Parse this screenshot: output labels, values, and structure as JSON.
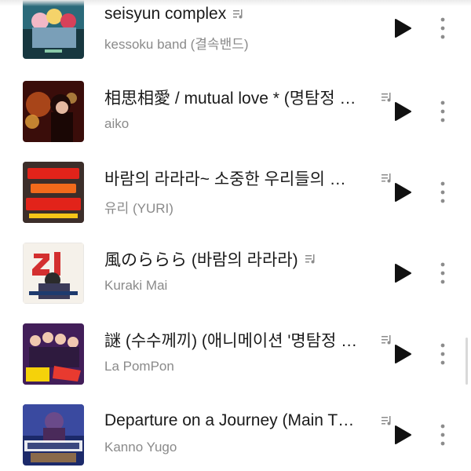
{
  "tracks": [
    {
      "title": "seisyun complex",
      "artist": "kessoku band (결속밴드)",
      "art_icon": "album-art-kessoku"
    },
    {
      "title": "相思相愛 / mutual love * (명탐정 코난 극장판 주제가)",
      "artist": "aiko",
      "art_icon": "album-art-aiko"
    },
    {
      "title": "바람의 라라라~ 소중한 우리들의 추억",
      "artist": "유리 (YURI)",
      "art_icon": "album-art-yuri"
    },
    {
      "title": "風のららら (바람의 라라라)",
      "artist": "Kuraki Mai",
      "art_icon": "album-art-kuraki"
    },
    {
      "title": "謎 (수수께끼) (애니메이션 '명탐정 코난' 오프닝)",
      "artist": "La PomPon",
      "art_icon": "album-art-lapompon"
    },
    {
      "title": "Departure on a Journey (Main Theme)",
      "artist": "Kanno Yugo",
      "art_icon": "album-art-sandland"
    }
  ],
  "icons": {
    "lyrics": "lyrics-icon",
    "play": "play-icon",
    "more": "more-vertical-icon"
  },
  "colors": {
    "title": "#1a1a1a",
    "artist": "#8a8a8a",
    "icon": "#111111",
    "more": "#8c8c8c"
  }
}
